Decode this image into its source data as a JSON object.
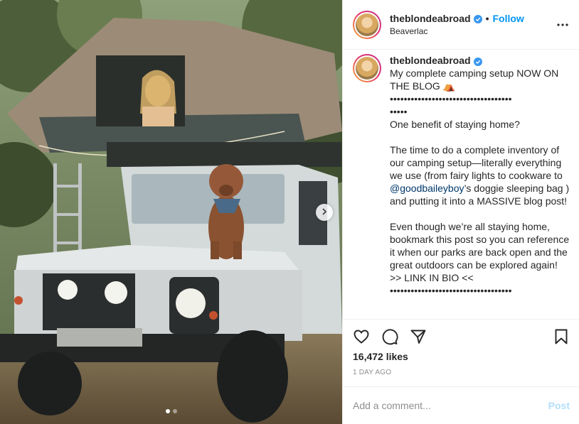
{
  "post": {
    "username": "theblondeabroad",
    "follow_label": "Follow",
    "separator": "•",
    "location": "Beaverlac",
    "caption": "My complete camping setup NOW ON THE BLOG ⛺\n•••••••••••••••••••••••••••••••••••\n•••••\nOne benefit of staying home?\n\nThe time to do a complete inventory of our camping setup—literally everything we use (from fairy lights to cookware to ",
    "mention": "@goodbaileyboy",
    "caption_after_mention": "’s doggie sleeping bag ) and putting it into a MASSIVE blog post!\n\nEven though we’re all staying home, bookmark this post so you can reference it when our parks are back open and the great outdoors can be explored again! >> LINK IN BIO <<\n•••••••••••••••••••••••••••••••••••",
    "likes": "16,472 likes",
    "time_ago": "1 DAY AGO",
    "comment_placeholder": "Add a comment...",
    "post_label": "Post"
  },
  "icons": {
    "verified": "verified-badge-icon",
    "more": "more-options-icon",
    "like": "heart-icon",
    "comment": "comment-bubble-icon",
    "share": "paper-plane-icon",
    "save": "bookmark-icon",
    "next": "chevron-right-icon"
  },
  "carousel": {
    "slides": 2,
    "active_index": 0
  },
  "colors": {
    "accent": "#0095f6",
    "verified": "#3897f0",
    "post_disabled": "#b2dffc",
    "muted": "#8e8e8e"
  }
}
